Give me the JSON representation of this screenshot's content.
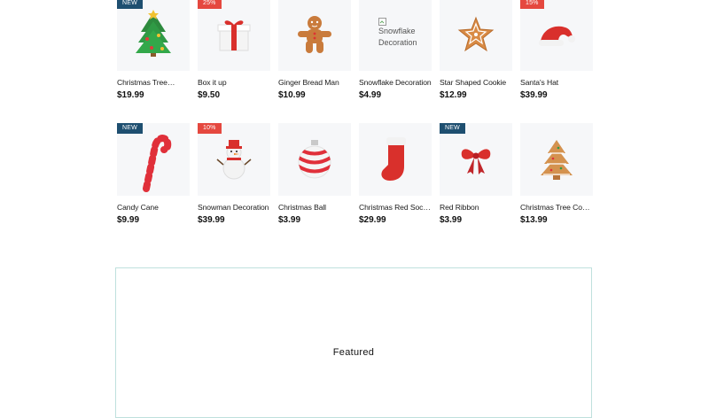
{
  "products_row_1": [
    {
      "badge": "NEW",
      "badge_type": "new",
      "name": "Christmas Tree…",
      "price": "$19.99",
      "icon": "christmas-tree-icon"
    },
    {
      "badge": "25%",
      "badge_type": "sale",
      "name": "Box it up",
      "price": "$9.50",
      "icon": "gift-box-icon"
    },
    {
      "badge": "",
      "badge_type": "",
      "name": "Ginger Bread Man",
      "price": "$10.99",
      "icon": "gingerbread-man-icon"
    },
    {
      "badge": "",
      "badge_type": "",
      "name": "Snowflake Decoration",
      "price": "$4.99",
      "icon": "broken-image-icon",
      "image_alt": "Snowflake Decoration"
    },
    {
      "badge": "",
      "badge_type": "",
      "name": "Star Shaped Cookie",
      "price": "$12.99",
      "icon": "star-cookie-icon"
    },
    {
      "badge": "15%",
      "badge_type": "sale",
      "name": "Santa's Hat",
      "price": "$39.99",
      "icon": "santa-hat-icon"
    }
  ],
  "products_row_2": [
    {
      "badge": "NEW",
      "badge_type": "new",
      "name": "Candy Cane",
      "price": "$9.99",
      "icon": "candy-cane-icon"
    },
    {
      "badge": "10%",
      "badge_type": "sale",
      "name": "Snowman Decoration",
      "price": "$39.99",
      "icon": "snowman-icon"
    },
    {
      "badge": "",
      "badge_type": "",
      "name": "Christmas Ball",
      "price": "$3.99",
      "icon": "christmas-ball-icon"
    },
    {
      "badge": "",
      "badge_type": "",
      "name": "Christmas Red Sock's",
      "price": "$29.99",
      "icon": "red-sock-icon"
    },
    {
      "badge": "NEW",
      "badge_type": "new",
      "name": "Red Ribbon",
      "price": "$3.99",
      "icon": "red-ribbon-icon"
    },
    {
      "badge": "",
      "badge_type": "",
      "name": "Christmas Tree Cookie",
      "price": "$13.99",
      "icon": "tree-cookie-icon"
    }
  ],
  "featured": {
    "title": "Featured"
  },
  "colors": {
    "badge_new": "#1e4f70",
    "badge_sale": "#e5483f",
    "card_bg": "#f6f7f9",
    "featured_border": "#bfe0dd"
  }
}
